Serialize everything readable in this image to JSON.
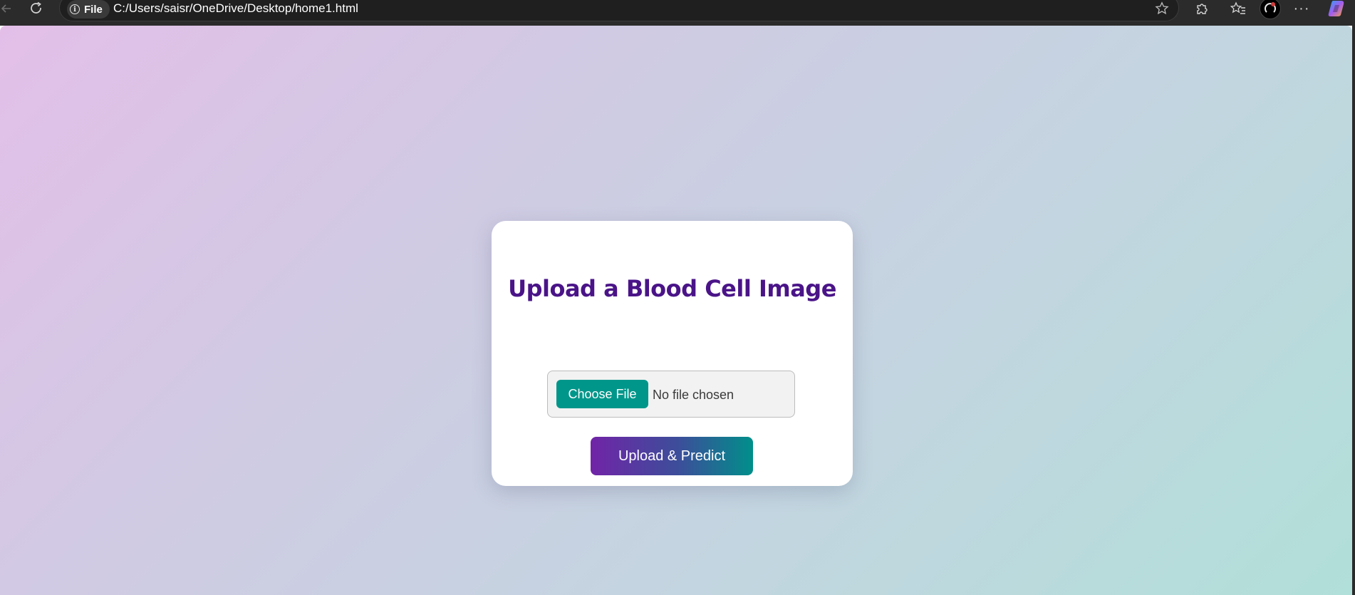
{
  "browser": {
    "file_label": "File",
    "url": "C:/Users/saisr/OneDrive/Desktop/home1.html"
  },
  "card": {
    "title": "Upload a Blood Cell Image",
    "choose_file_label": "Choose File",
    "file_status": "No file chosen",
    "submit_label": "Upload & Predict"
  },
  "colors": {
    "title": "#4a1488",
    "choose_button": "#00968a",
    "submit_gradient_start": "#7124a7",
    "submit_gradient_end": "#008f8a",
    "background_start": "#e3bfe8",
    "background_end": "#b1dfd9"
  },
  "icons": {
    "back": "arrow-left-icon",
    "refresh": "refresh-icon",
    "info": "info-icon",
    "favorite": "star-icon",
    "extensions": "puzzle-icon",
    "favorites": "favorites-icon",
    "profile": "avatar",
    "more": "more-icon",
    "copilot": "copilot-icon"
  }
}
